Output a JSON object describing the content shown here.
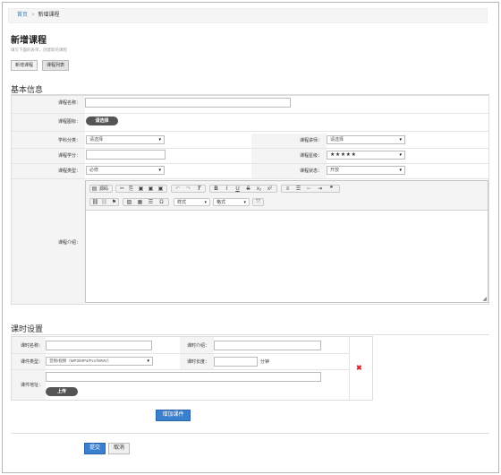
{
  "breadcrumb": {
    "home": "首页",
    "sep": ">",
    "current": "新增课程"
  },
  "page": {
    "title": "新增课程",
    "subtitle": "填写下面的表单，创建新的课程"
  },
  "tabs": [
    "新增课程",
    "课程列表"
  ],
  "basic": {
    "section_title": "基本信息",
    "course_name_label": "课程名称：",
    "course_icon_label": "课程图标：",
    "choose_image_btn": "请选择",
    "subject_label": "学科分类：",
    "subject_value": "请选择",
    "teacher_label": "课程讲师：",
    "teacher_value": "请选择",
    "credits_label": "课程学分：",
    "rating_label": "课程星级：",
    "rating_value": "★★★★★",
    "type_label": "课程类型：",
    "type_value": "必修",
    "status_label": "课程状态：",
    "status_value": "开放",
    "intro_label": "课程介绍：",
    "editor": {
      "source_label": "源码",
      "style_label": "样式",
      "format_label": "格式"
    }
  },
  "lesson": {
    "section_title": "课时设置",
    "name_label": "课时名称：",
    "intro_label": "课时介绍：",
    "type_label": "课件类型：",
    "type_value": "音频/视频（MP3/MP4/FLV/WMV）",
    "duration_label": "课时长度：",
    "duration_unit": "分钟",
    "url_label": "课件地址：",
    "upload_btn": "上传",
    "delete_icon": "✖",
    "add_btn": "增加课件"
  },
  "actions": {
    "submit": "提交",
    "cancel": "取消"
  },
  "colors": {
    "accent": "#3a7fd0",
    "delete": "#d62a2a",
    "link": "#2f82c4"
  }
}
